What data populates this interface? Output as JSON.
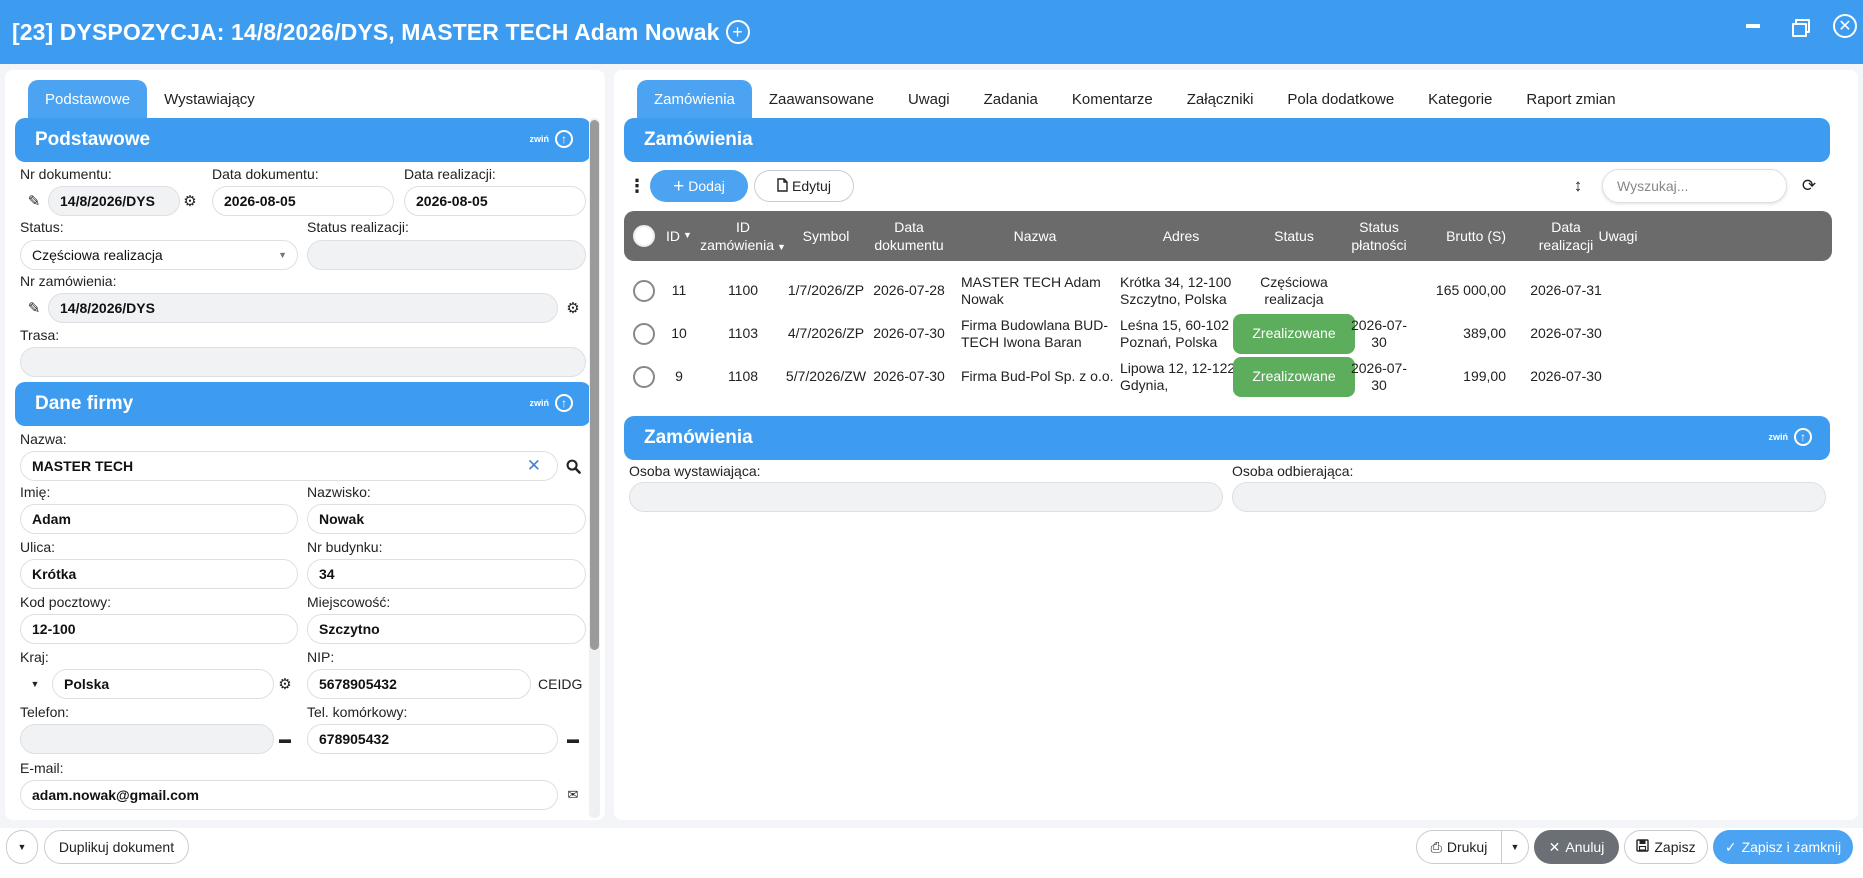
{
  "window": {
    "title": "[23] DYSPOZYCJA: 14/8/2026/DYS, MASTER TECH Adam Nowak"
  },
  "left": {
    "tabs": [
      "Podstawowe",
      "Wystawiający"
    ],
    "section1": {
      "title": "Podstawowe",
      "collapse_label": "zwiń",
      "nr_dokumentu_label": "Nr dokumentu:",
      "nr_dokumentu": "14/8/2026/DYS",
      "data_dokumentu_label": "Data dokumentu:",
      "data_dokumentu": "2026-08-05",
      "data_realizacji_label": "Data realizacji:",
      "data_realizacji": "2026-08-05",
      "status_label": "Status:",
      "status": "Częściowa realizacja",
      "status_realizacji_label": "Status realizacji:",
      "status_realizacji": "",
      "nr_zamowienia_label": "Nr zamówienia:",
      "nr_zamowienia": "14/8/2026/DYS",
      "trasa_label": "Trasa:",
      "trasa": ""
    },
    "section2": {
      "title": "Dane firmy",
      "collapse_label": "zwiń",
      "nazwa_label": "Nazwa:",
      "nazwa": "MASTER TECH",
      "imie_label": "Imię:",
      "imie": "Adam",
      "nazwisko_label": "Nazwisko:",
      "nazwisko": "Nowak",
      "ulica_label": "Ulica:",
      "ulica": "Krótka",
      "nr_budynku_label": "Nr budynku:",
      "nr_budynku": "34",
      "kod_label": "Kod pocztowy:",
      "kod": "12-100",
      "miejscowosc_label": "Miejscowość:",
      "miejscowosc": "Szczytno",
      "kraj_label": "Kraj:",
      "kraj": "Polska",
      "nip_label": "NIP:",
      "nip": "5678905432",
      "ceidg": "CEIDG",
      "telefon_label": "Telefon:",
      "telefon": "",
      "tel_kom_label": "Tel. komórkowy:",
      "tel_kom": "678905432",
      "email_label": "E-mail:",
      "email": "adam.nowak@gmail.com"
    }
  },
  "right": {
    "tabs": [
      "Zamówienia",
      "Zaawansowane",
      "Uwagi",
      "Zadania",
      "Komentarze",
      "Załączniki",
      "Pola dodatkowe",
      "Kategorie",
      "Raport zmian"
    ],
    "section_title": "Zamówienia",
    "add_label": "Dodaj",
    "edit_label": "Edytuj",
    "search_placeholder": "Wyszukaj...",
    "columns": {
      "id": "ID",
      "id_zam_1": "ID",
      "id_zam_2": "zamówienia",
      "symbol": "Symbol",
      "data_dok_1": "Data",
      "data_dok_2": "dokumentu",
      "nazwa": "Nazwa",
      "adres": "Adres",
      "status": "Status",
      "status_pl_1": "Status",
      "status_pl_2": "płatności",
      "brutto": "Brutto (S)",
      "data_real_1": "Data",
      "data_real_2": "realizacji",
      "uwagi": "Uwagi"
    },
    "rows": [
      {
        "id": "11",
        "id_zam": "1100",
        "symbol": "1/7/2026/ZP",
        "data_dok": "2026-07-28",
        "nazwa_1": "MASTER TECH Adam",
        "nazwa_2": "Nowak",
        "adres_1": "Krótka 34, 12-100",
        "adres_2": "Szczytno, Polska",
        "status_1": "Częściowa",
        "status_2": "realizacja",
        "status_pl_1": "",
        "status_pl_2": "",
        "brutto": "165 000,00",
        "data_real": "2026-07-31"
      },
      {
        "id": "10",
        "id_zam": "1103",
        "symbol": "4/7/2026/ZP",
        "data_dok": "2026-07-30",
        "nazwa_1": "Firma Budowlana BUD-",
        "nazwa_2": "TECH Iwona Baran",
        "adres_1": "Leśna 15, 60-102",
        "adres_2": "Poznań, Polska",
        "status_badge": "Zrealizowane",
        "status_pl_1": "2026-07-",
        "status_pl_2": "30",
        "brutto": "389,00",
        "data_real": "2026-07-30"
      },
      {
        "id": "9",
        "id_zam": "1108",
        "symbol": "5/7/2026/ZW",
        "data_dok": "2026-07-30",
        "nazwa_1": "Firma Bud-Pol Sp. z o.o.",
        "nazwa_2": "",
        "adres_1": "Lipowa 12, 12-122",
        "adres_2": "Gdynia,",
        "status_badge": "Zrealizowane",
        "status_pl_1": "2026-07-",
        "status_pl_2": "30",
        "brutto": "199,00",
        "data_real": "2026-07-30"
      }
    ],
    "section2_title": "Zamówienia",
    "collapse_label": "zwiń",
    "osoba_wyst_label": "Osoba wystawiająca:",
    "osoba_wyst": "",
    "osoba_odb_label": "Osoba odbierająca:",
    "osoba_odb": ""
  },
  "footer": {
    "duplicate_label": "Duplikuj dokument",
    "print_label": "Drukuj",
    "cancel_label": "Anuluj",
    "save_label": "Zapisz",
    "save_close_label": "Zapisz i zamknij"
  }
}
